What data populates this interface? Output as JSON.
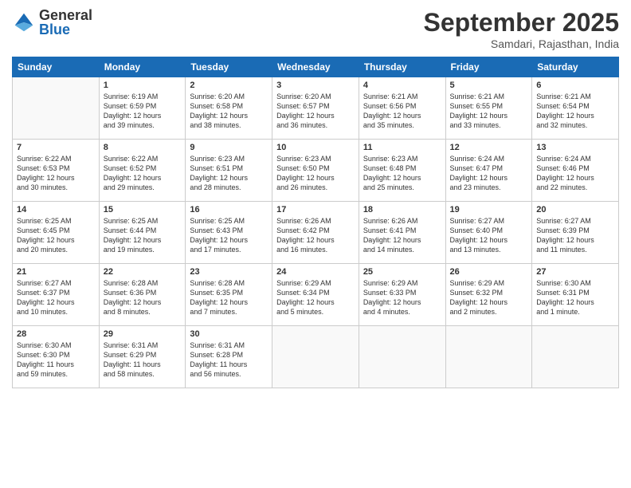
{
  "logo": {
    "general": "General",
    "blue": "Blue"
  },
  "title": "September 2025",
  "subtitle": "Samdari, Rajasthan, India",
  "headers": [
    "Sunday",
    "Monday",
    "Tuesday",
    "Wednesday",
    "Thursday",
    "Friday",
    "Saturday"
  ],
  "weeks": [
    [
      {
        "day": "",
        "info": ""
      },
      {
        "day": "1",
        "info": "Sunrise: 6:19 AM\nSunset: 6:59 PM\nDaylight: 12 hours\nand 39 minutes."
      },
      {
        "day": "2",
        "info": "Sunrise: 6:20 AM\nSunset: 6:58 PM\nDaylight: 12 hours\nand 38 minutes."
      },
      {
        "day": "3",
        "info": "Sunrise: 6:20 AM\nSunset: 6:57 PM\nDaylight: 12 hours\nand 36 minutes."
      },
      {
        "day": "4",
        "info": "Sunrise: 6:21 AM\nSunset: 6:56 PM\nDaylight: 12 hours\nand 35 minutes."
      },
      {
        "day": "5",
        "info": "Sunrise: 6:21 AM\nSunset: 6:55 PM\nDaylight: 12 hours\nand 33 minutes."
      },
      {
        "day": "6",
        "info": "Sunrise: 6:21 AM\nSunset: 6:54 PM\nDaylight: 12 hours\nand 32 minutes."
      }
    ],
    [
      {
        "day": "7",
        "info": "Sunrise: 6:22 AM\nSunset: 6:53 PM\nDaylight: 12 hours\nand 30 minutes."
      },
      {
        "day": "8",
        "info": "Sunrise: 6:22 AM\nSunset: 6:52 PM\nDaylight: 12 hours\nand 29 minutes."
      },
      {
        "day": "9",
        "info": "Sunrise: 6:23 AM\nSunset: 6:51 PM\nDaylight: 12 hours\nand 28 minutes."
      },
      {
        "day": "10",
        "info": "Sunrise: 6:23 AM\nSunset: 6:50 PM\nDaylight: 12 hours\nand 26 minutes."
      },
      {
        "day": "11",
        "info": "Sunrise: 6:23 AM\nSunset: 6:48 PM\nDaylight: 12 hours\nand 25 minutes."
      },
      {
        "day": "12",
        "info": "Sunrise: 6:24 AM\nSunset: 6:47 PM\nDaylight: 12 hours\nand 23 minutes."
      },
      {
        "day": "13",
        "info": "Sunrise: 6:24 AM\nSunset: 6:46 PM\nDaylight: 12 hours\nand 22 minutes."
      }
    ],
    [
      {
        "day": "14",
        "info": "Sunrise: 6:25 AM\nSunset: 6:45 PM\nDaylight: 12 hours\nand 20 minutes."
      },
      {
        "day": "15",
        "info": "Sunrise: 6:25 AM\nSunset: 6:44 PM\nDaylight: 12 hours\nand 19 minutes."
      },
      {
        "day": "16",
        "info": "Sunrise: 6:25 AM\nSunset: 6:43 PM\nDaylight: 12 hours\nand 17 minutes."
      },
      {
        "day": "17",
        "info": "Sunrise: 6:26 AM\nSunset: 6:42 PM\nDaylight: 12 hours\nand 16 minutes."
      },
      {
        "day": "18",
        "info": "Sunrise: 6:26 AM\nSunset: 6:41 PM\nDaylight: 12 hours\nand 14 minutes."
      },
      {
        "day": "19",
        "info": "Sunrise: 6:27 AM\nSunset: 6:40 PM\nDaylight: 12 hours\nand 13 minutes."
      },
      {
        "day": "20",
        "info": "Sunrise: 6:27 AM\nSunset: 6:39 PM\nDaylight: 12 hours\nand 11 minutes."
      }
    ],
    [
      {
        "day": "21",
        "info": "Sunrise: 6:27 AM\nSunset: 6:37 PM\nDaylight: 12 hours\nand 10 minutes."
      },
      {
        "day": "22",
        "info": "Sunrise: 6:28 AM\nSunset: 6:36 PM\nDaylight: 12 hours\nand 8 minutes."
      },
      {
        "day": "23",
        "info": "Sunrise: 6:28 AM\nSunset: 6:35 PM\nDaylight: 12 hours\nand 7 minutes."
      },
      {
        "day": "24",
        "info": "Sunrise: 6:29 AM\nSunset: 6:34 PM\nDaylight: 12 hours\nand 5 minutes."
      },
      {
        "day": "25",
        "info": "Sunrise: 6:29 AM\nSunset: 6:33 PM\nDaylight: 12 hours\nand 4 minutes."
      },
      {
        "day": "26",
        "info": "Sunrise: 6:29 AM\nSunset: 6:32 PM\nDaylight: 12 hours\nand 2 minutes."
      },
      {
        "day": "27",
        "info": "Sunrise: 6:30 AM\nSunset: 6:31 PM\nDaylight: 12 hours\nand 1 minute."
      }
    ],
    [
      {
        "day": "28",
        "info": "Sunrise: 6:30 AM\nSunset: 6:30 PM\nDaylight: 11 hours\nand 59 minutes."
      },
      {
        "day": "29",
        "info": "Sunrise: 6:31 AM\nSunset: 6:29 PM\nDaylight: 11 hours\nand 58 minutes."
      },
      {
        "day": "30",
        "info": "Sunrise: 6:31 AM\nSunset: 6:28 PM\nDaylight: 11 hours\nand 56 minutes."
      },
      {
        "day": "",
        "info": ""
      },
      {
        "day": "",
        "info": ""
      },
      {
        "day": "",
        "info": ""
      },
      {
        "day": "",
        "info": ""
      }
    ]
  ]
}
